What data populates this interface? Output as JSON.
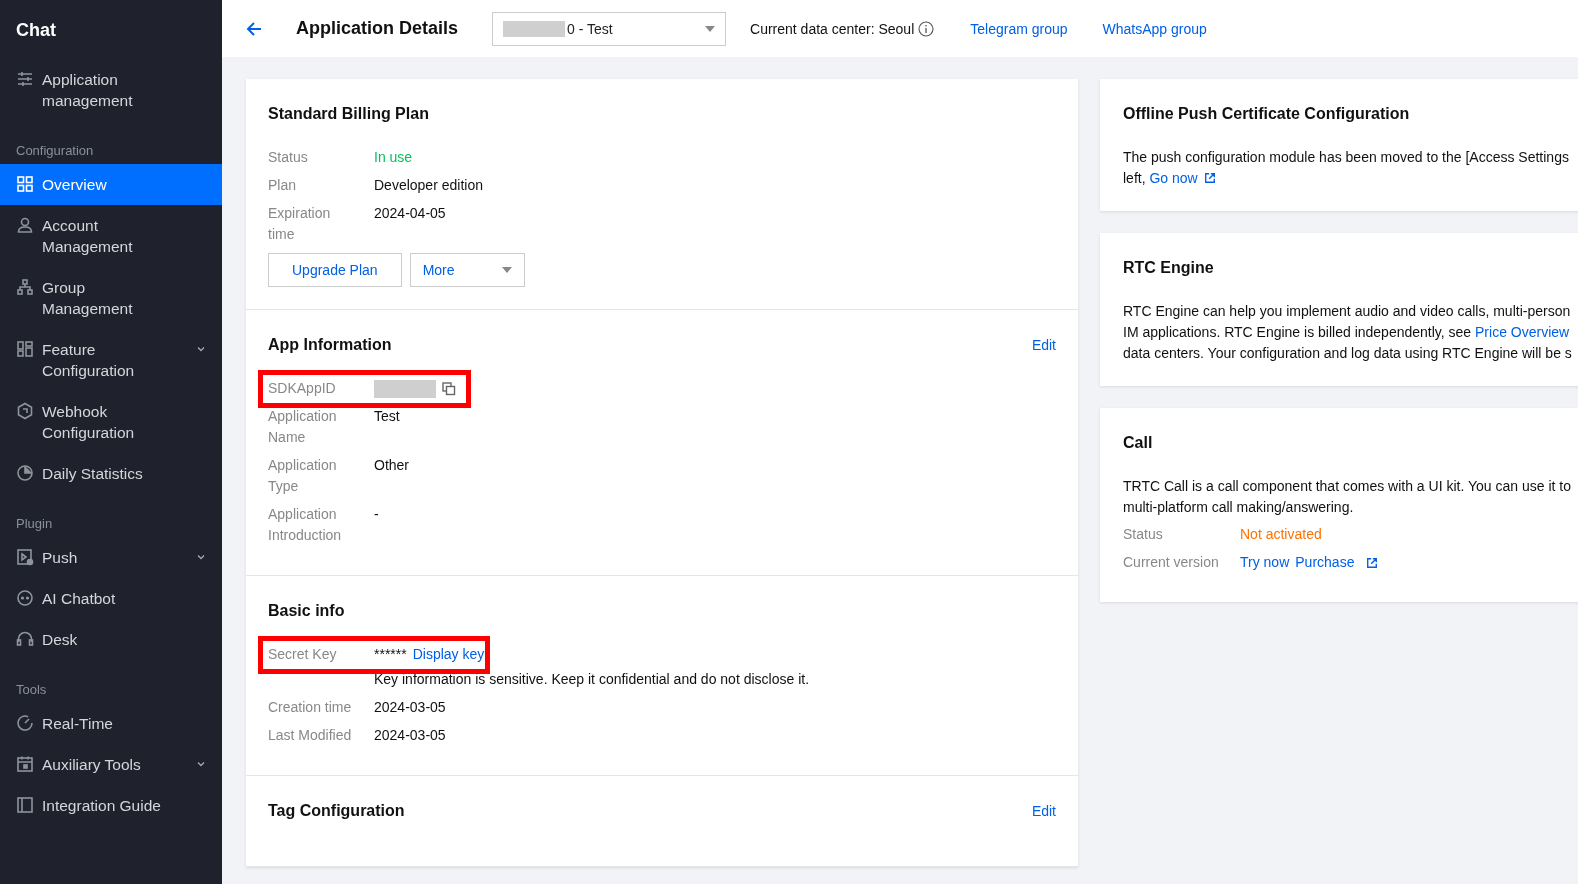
{
  "sidebar": {
    "title": "Chat",
    "groups": [
      {
        "items": [
          {
            "label": "Application management",
            "selected": false,
            "expandable": false
          }
        ]
      },
      {
        "heading": "Configuration",
        "items": [
          {
            "label": "Overview",
            "selected": true,
            "expandable": false
          },
          {
            "label": "Account Management",
            "selected": false,
            "expandable": false
          },
          {
            "label": "Group Management",
            "selected": false,
            "expandable": false
          },
          {
            "label": "Feature Configuration",
            "selected": false,
            "expandable": true
          },
          {
            "label": "Webhook Configuration",
            "selected": false,
            "expandable": false
          },
          {
            "label": "Daily Statistics",
            "selected": false,
            "expandable": false
          }
        ]
      },
      {
        "heading": "Plugin",
        "items": [
          {
            "label": "Push",
            "selected": false,
            "expandable": true
          },
          {
            "label": "AI Chatbot",
            "selected": false,
            "expandable": false
          },
          {
            "label": "Desk",
            "selected": false,
            "expandable": false
          }
        ]
      },
      {
        "heading": "Tools",
        "items": [
          {
            "label": "Real-Time",
            "selected": false,
            "expandable": false
          },
          {
            "label": "Auxiliary Tools",
            "selected": false,
            "expandable": true
          },
          {
            "label": "Integration Guide",
            "selected": false,
            "expandable": false
          }
        ]
      }
    ]
  },
  "header": {
    "title": "Application Details",
    "app_select": {
      "value": "0 - Test",
      "redacted": true
    },
    "data_center": "Current data center: Seoul",
    "links": [
      "Telegram group",
      "WhatsApp group"
    ]
  },
  "left_sections": [
    {
      "title": "Standard Billing Plan",
      "fields": [
        {
          "label": "Status",
          "value": "In use",
          "kind": "success"
        },
        {
          "label": "Plan",
          "value": "Developer edition",
          "kind": "text"
        },
        {
          "label": "Expiration time",
          "value": "2024-04-05",
          "kind": "text"
        }
      ],
      "buttons": [
        {
          "label": "Upgrade Plan",
          "kind": "plain"
        },
        {
          "label": "More",
          "kind": "dropdown"
        }
      ]
    },
    {
      "title": "App Information",
      "action": "Edit",
      "fields": [
        {
          "label": "SDKAppID",
          "kind": "redacted",
          "highlighted": true
        },
        {
          "label": "Application Name",
          "value": "Test",
          "kind": "text"
        },
        {
          "label": "Application Type",
          "value": "Other",
          "kind": "text"
        },
        {
          "label": "Application Introduction",
          "value": "-",
          "kind": "text"
        }
      ]
    },
    {
      "title": "Basic info",
      "fields": [
        {
          "label": "Secret Key",
          "value": "******",
          "link": "Display key",
          "note": "Key information is sensitive. Keep it confidential and do not disclose it.",
          "kind": "secret",
          "highlighted": true
        },
        {
          "label": "Creation time",
          "value": "2024-03-05",
          "kind": "text"
        },
        {
          "label": "Last Modified",
          "value": "2024-03-05",
          "kind": "text"
        }
      ]
    },
    {
      "title": "Tag Configuration",
      "action": "Edit"
    }
  ],
  "right_cards": [
    {
      "title": "Offline Push Certificate Configuration",
      "lines": [
        {
          "text": "The push configuration module has been moved to the [Access Settings"
        },
        {
          "text": "left, ",
          "link": "Go now",
          "external": true
        }
      ]
    },
    {
      "title": "RTC Engine",
      "lines": [
        {
          "text": "RTC Engine can help you implement audio and video calls, multi-person"
        },
        {
          "text": "IM applications. RTC Engine is billed independently, see ",
          "link": "Price Overview"
        },
        {
          "text": "data centers. Your configuration and log data using RTC Engine will be s"
        }
      ]
    },
    {
      "title": "Call",
      "lines": [
        {
          "text": "TRTC Call is a call component that comes with a UI kit. You can use it to"
        },
        {
          "text": "multi-platform call making/answering."
        }
      ],
      "fields": [
        {
          "label": "Status",
          "value": "Not activated",
          "kind": "warning"
        },
        {
          "label": "Current version",
          "links": [
            "Try now",
            "Purchase"
          ],
          "external": true,
          "kind": "links"
        }
      ]
    }
  ]
}
